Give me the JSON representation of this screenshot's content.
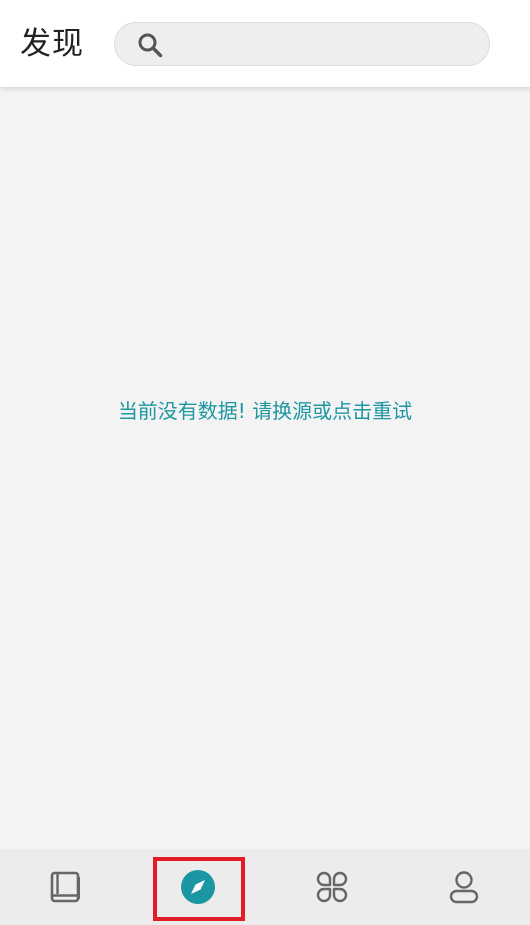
{
  "header": {
    "title": "发现",
    "search": {
      "value": "",
      "placeholder": ""
    }
  },
  "content": {
    "empty_message": "当前没有数据! 请换源或点击重试"
  },
  "bottom_nav": {
    "items": [
      {
        "id": "bookshelf",
        "icon": "book-icon",
        "active": false
      },
      {
        "id": "discover",
        "icon": "compass-icon",
        "active": true
      },
      {
        "id": "rss",
        "icon": "command-icon",
        "active": false
      },
      {
        "id": "my",
        "icon": "person-icon",
        "active": false
      }
    ],
    "active_color": "#1a97a3",
    "inactive_color": "#666666"
  },
  "colors": {
    "accent": "#1e97a1",
    "highlight": "#e21b26",
    "background": "#f3f3f3"
  }
}
